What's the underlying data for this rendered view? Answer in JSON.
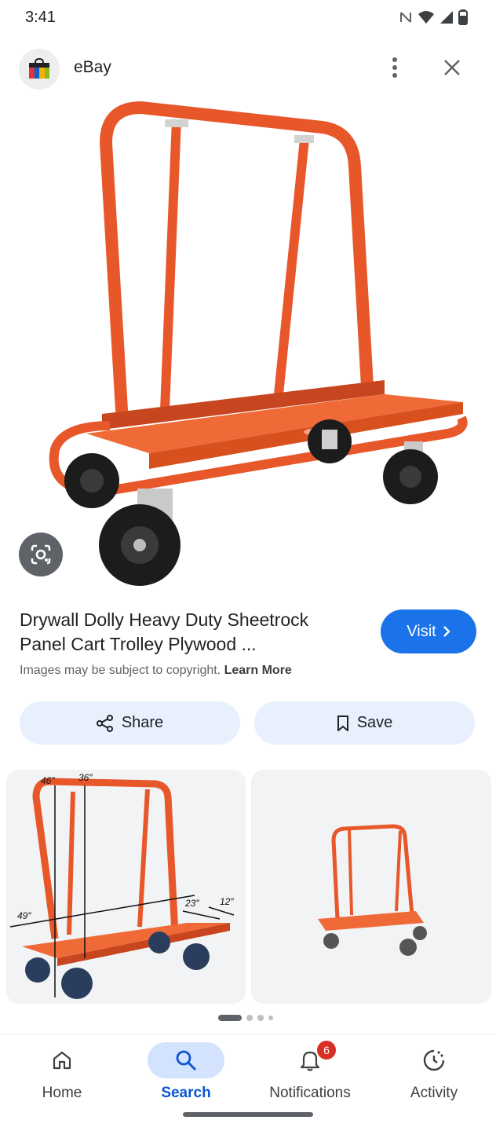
{
  "status_bar": {
    "time": "3:41",
    "icons": [
      "nfc-icon",
      "wifi-icon",
      "signal-icon",
      "battery-icon"
    ]
  },
  "header": {
    "site_name": "eBay",
    "icons": [
      "ebay-logo",
      "more-vert-icon",
      "close-icon"
    ]
  },
  "main_image": {
    "subject": "orange drywall dolly cart",
    "lens_icon": "google-lens-icon"
  },
  "result": {
    "title": "Drywall Dolly Heavy Duty Sheetrock Panel Cart Trolley Plywood ...",
    "visit_label": "Visit",
    "copyright_text": "Images may be subject to copyright.",
    "learn_more": "Learn More"
  },
  "actions": {
    "share_label": "Share",
    "save_label": "Save"
  },
  "related": {
    "dimensions": [
      "46″",
      "36″",
      "49″",
      "23″",
      "12″"
    ]
  },
  "bottom_nav": {
    "items": [
      {
        "label": "Home",
        "icon": "home-icon"
      },
      {
        "label": "Search",
        "icon": "search-icon"
      },
      {
        "label": "Notifications",
        "icon": "bell-icon",
        "badge": "6"
      },
      {
        "label": "Activity",
        "icon": "activity-icon"
      }
    ],
    "active_color": "#0b57d0"
  },
  "colors": {
    "accent": "#1a73e8",
    "product_orange": "#e8572a"
  }
}
